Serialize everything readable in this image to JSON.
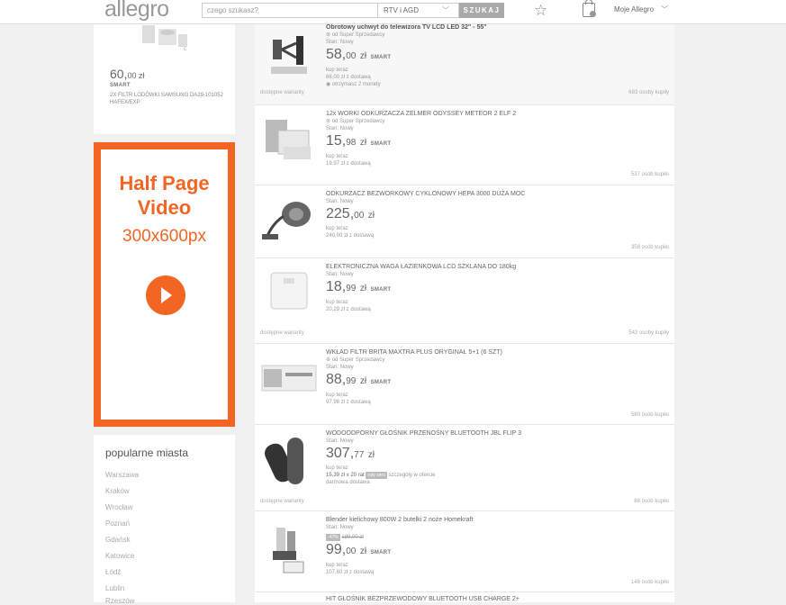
{
  "header": {
    "logo": "allegro",
    "search_placeholder": "czego szukasz?",
    "category": "RTV i AGD",
    "search_button": "SZUKAJ",
    "account": "Moje Allegro"
  },
  "left_product": {
    "price_int": "60,",
    "price_dec": "00 zł",
    "smart": "SMART",
    "title": "2X FILTR LODÓWKI SAMSUNG DA29-10105J HAFEX/EXP"
  },
  "ad": {
    "line1": "Half Page",
    "line2": "Video",
    "size": "300x600px"
  },
  "cities": {
    "heading": "popularne miasta",
    "items": [
      "Warszawa",
      "Kraków",
      "Wrocław",
      "Poznań",
      "Gdańsk",
      "Katowice",
      "Łódź",
      "Lublin",
      "Rzeszów"
    ]
  },
  "items": [
    {
      "title": "Obrotowy uchwyt do telewizora TV LCD LED 32\" - 55\"",
      "seller": "od Super Sprzedawcy",
      "condition": "Stan: Nowy",
      "price_int": "58,",
      "price_dec": "00",
      "zl": "zł",
      "smart": "SMART",
      "buy": "kup teraz",
      "delivery": "66,00 zł z dostawą",
      "coins": "otrzymasz 2 monety",
      "variants": "dostępne warianty",
      "buyers": "683 osoby kupiły"
    },
    {
      "title": "12x WORKI ODKURZACZA ZELMER ODYSSEY METEOR 2 ELF 2",
      "seller": "od Super Sprzedawcy",
      "condition": "Stan: Nowy",
      "price_int": "15,",
      "price_dec": "98",
      "zl": "zł",
      "smart": "SMART",
      "buy": "kup teraz",
      "delivery": "19,97 zł z dostawą",
      "buyers": "537 osób kupiło"
    },
    {
      "title": "ODKURZACZ BEZWORKOWY CYKLONOWY HEPA 3000 DUŻA MOC",
      "condition": "Stan: Nowy",
      "price_int": "225,",
      "price_dec": "00",
      "zl": "zł",
      "buy": "kup teraz",
      "delivery": "240,00 zł z dostawą",
      "buyers": "358 osób kupiło"
    },
    {
      "title": "ELEKTRONICZNA WAGA ŁAZIENKOWA LCD SZKLANA DO 180kg",
      "condition": "Stan: Nowy",
      "price_int": "18,",
      "price_dec": "99",
      "zl": "zł",
      "smart": "SMART",
      "buy": "kup teraz",
      "delivery": "20,29 zł z dostawą",
      "variants": "dostępne warianty",
      "buyers": "542 osoby kupiły"
    },
    {
      "title": "WKŁAD FILTR BRITA MAXTRA PLUS ORYGINAŁ 5+1 (6 SZT)",
      "seller": "od Super Sprzedawcy",
      "condition": "Stan: Nowy",
      "price_int": "88,",
      "price_dec": "99",
      "zl": "zł",
      "smart": "SMART",
      "buy": "kup teraz",
      "delivery": "97,98 zł z dostawą",
      "buyers": "580 osób kupiło"
    },
    {
      "title": "WODOODPORNY GŁOŚNIK PRZENOŚNY BLUETOOTH JBL FLIP 3",
      "condition": "Stan: Nowy",
      "price_int": "307,",
      "price_dec": "77",
      "zl": "zł",
      "buy": "kup teraz",
      "installment": "15,39 zł x 20 rat",
      "installment_badge": "raty zero",
      "installment_more": "szczegóły w ofercie",
      "delivery": "darmowa dostawa",
      "variants": "dostępne warianty",
      "buyers": "88 osób kupiło"
    },
    {
      "title": "Blender kielichowy 800W 2 butelki 2 noże Homekraft",
      "condition": "Stan: Nowy",
      "discount": "-47%",
      "old_price": "189,00 zł",
      "price_int": "99,",
      "price_dec": "00",
      "zl": "zł",
      "smart": "SMART",
      "buy": "kup teraz",
      "delivery": "107,60 zł z dostawą",
      "buyers": "146 osób kupiło"
    },
    {
      "title": "HIT GŁOŚNIK BEZPRZEWODOWY BLUETOOTH USB CHARGE 2+"
    }
  ]
}
